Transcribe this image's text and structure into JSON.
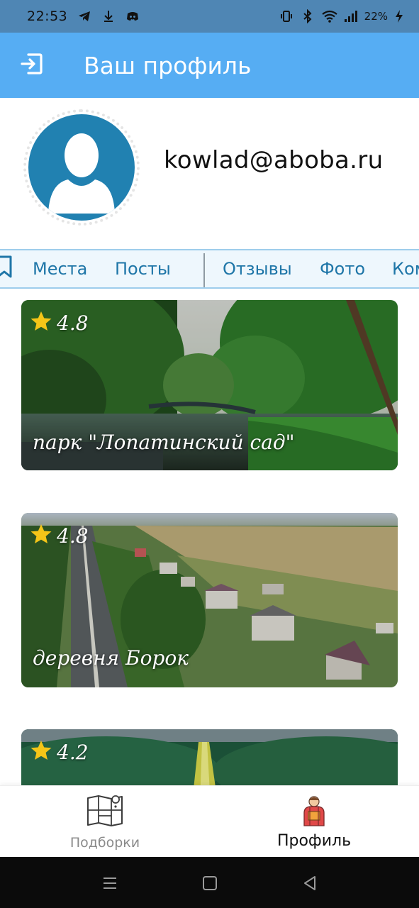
{
  "status_bar": {
    "time": "22:53",
    "battery": "22%",
    "icons_left": [
      "telegram-icon",
      "download-icon",
      "discord-icon"
    ],
    "icons_right": [
      "vibrate-icon",
      "bluetooth-icon",
      "wifi-icon",
      "signal-icon",
      "charging-icon"
    ]
  },
  "app_bar": {
    "title": "Ваш профиль",
    "background": "#56adf3",
    "logout_icon": "logout-icon"
  },
  "profile": {
    "email": "kowlad@aboba.ru",
    "avatar_color": "#2181b1"
  },
  "tabs": {
    "items": [
      {
        "icon": "bookmark-icon"
      },
      {
        "label": "Места"
      },
      {
        "label": "Посты"
      },
      {
        "label": "Отзывы"
      },
      {
        "label": "Фото"
      },
      {
        "label": "Ком"
      }
    ],
    "text_color": "#1f76a8"
  },
  "places": [
    {
      "rating": "4.8",
      "title": "парк \"Лопатинский сад\""
    },
    {
      "rating": "4.8",
      "title": "деревня Борок"
    },
    {
      "rating": "4.2",
      "title": ""
    }
  ],
  "bottom_nav": {
    "items": [
      {
        "label": "Подборки",
        "icon": "map-icon",
        "active": false
      },
      {
        "label": "Профиль",
        "icon": "traveler-icon",
        "active": true
      }
    ]
  },
  "system_nav": {
    "icons": [
      "menu-icon",
      "home-icon",
      "back-icon"
    ]
  }
}
